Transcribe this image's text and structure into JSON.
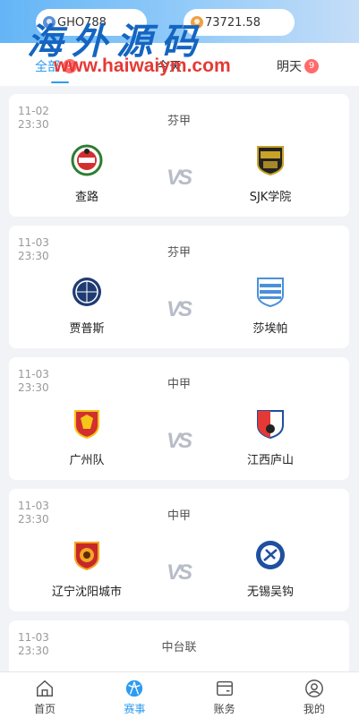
{
  "header": {
    "username": "GHO788",
    "balance": "73721.58",
    "user_icon": "user-badge-icon",
    "balance_icon": "coin-icon"
  },
  "watermark": {
    "cn": "海外源码",
    "url": "www.haiwaiym.com"
  },
  "tabs": [
    {
      "label": "全部",
      "badge": "5",
      "active": true
    },
    {
      "label": "今天",
      "badge": "",
      "active": false
    },
    {
      "label": "明天",
      "badge": "9",
      "active": false
    }
  ],
  "matches": [
    {
      "date": "11-02",
      "time": "23:30",
      "league": "芬甲",
      "home": "查路",
      "away": "SJK学院",
      "vs": "VS"
    },
    {
      "date": "11-03",
      "time": "23:30",
      "league": "芬甲",
      "home": "贾普斯",
      "away": "莎埃帕",
      "vs": "VS"
    },
    {
      "date": "11-03",
      "time": "23:30",
      "league": "中甲",
      "home": "广州队",
      "away": "江西庐山",
      "vs": "VS"
    },
    {
      "date": "11-03",
      "time": "23:30",
      "league": "中甲",
      "home": "辽宁沈阳城市",
      "away": "无锡吴钩",
      "vs": "VS"
    },
    {
      "date": "11-03",
      "time": "23:30",
      "league": "中台联",
      "home": "",
      "away": "",
      "vs": ""
    }
  ],
  "tabbar": [
    {
      "label": "首页",
      "icon": "home-icon",
      "active": false
    },
    {
      "label": "赛事",
      "icon": "soccer-ball-icon",
      "active": true
    },
    {
      "label": "账务",
      "icon": "wallet-icon",
      "active": false
    },
    {
      "label": "我的",
      "icon": "profile-icon",
      "active": false
    }
  ],
  "colors": {
    "accent": "#2d9cf0",
    "badge": "#ff6b6b",
    "watermark_cn": "#1565c0",
    "watermark_url": "#e53935"
  }
}
